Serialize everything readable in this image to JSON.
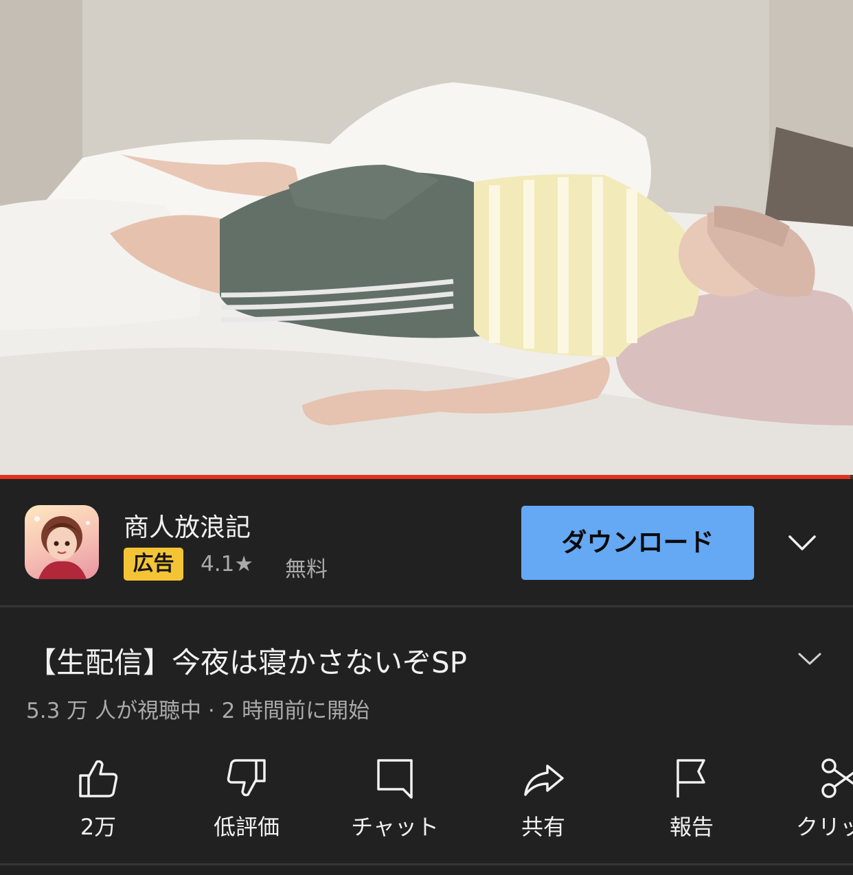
{
  "video": {
    "progress_fraction": 0.997
  },
  "ad": {
    "icon": "game-app-icon",
    "title": "商人放浪記",
    "badge": "広告",
    "rating": "4.1★",
    "price": "無料",
    "download_label": "ダウンロード",
    "expand_icon": "chevron-down-icon",
    "colors": {
      "badge": "#f5c436",
      "button": "#65a8f4"
    }
  },
  "main": {
    "title": "【生配信】今夜は寝かさないぞSP",
    "meta": "5.3 万 人が視聴中 · 2 時間前に開始",
    "expand_icon": "chevron-down-icon"
  },
  "actions": [
    {
      "icon": "thumbs-up-icon",
      "label": "2万"
    },
    {
      "icon": "thumbs-down-icon",
      "label": "低評価"
    },
    {
      "icon": "chat-icon",
      "label": "チャット"
    },
    {
      "icon": "share-icon",
      "label": "共有"
    },
    {
      "icon": "flag-icon",
      "label": "報告"
    },
    {
      "icon": "scissors-icon",
      "label": "クリップ"
    }
  ],
  "colors": {
    "background": "#212121",
    "progress": "#e3321f",
    "secondary_text": "#aaaaaa"
  }
}
